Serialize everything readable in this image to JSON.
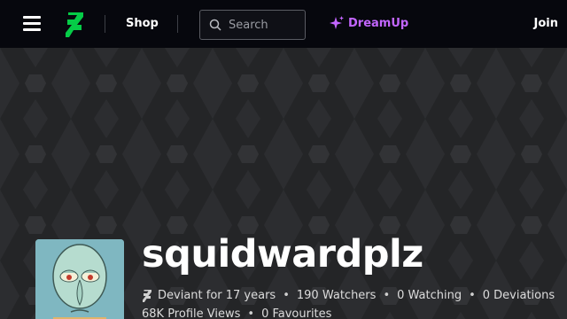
{
  "topbar": {
    "shop_label": "Shop",
    "search_placeholder": "Search",
    "dreamup_label": "DreamUp",
    "join_label": "Join"
  },
  "colors": {
    "topbar_bg": "#06070d",
    "brand_green": "#05cc47",
    "dreamup_purple": "#c366ff",
    "banner_bg": "#2c2d30"
  },
  "icons": [
    "menu-icon",
    "deviantart-logo-icon",
    "search-icon",
    "dreamup-sparkle-icon",
    "deviant-badge-icon"
  ],
  "profile": {
    "username": "squidwardplz",
    "stats_row1": [
      "Deviant for 17 years",
      "190 Watchers",
      "0 Watching",
      "0 Deviations"
    ],
    "stats_row2": [
      "68K Profile Views",
      "0 Favourites"
    ]
  }
}
